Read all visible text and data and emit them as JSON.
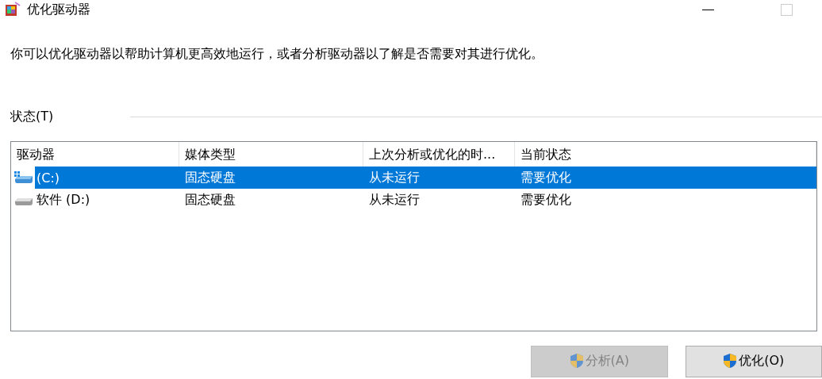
{
  "window": {
    "title": "优化驱动器"
  },
  "description": "你可以优化驱动器以帮助计算机更高效地运行，或者分析驱动器以了解是否需要对其进行优化。",
  "status_group": {
    "label": "状态(T)"
  },
  "table": {
    "columns": [
      "驱动器",
      "媒体类型",
      "上次分析或优化的时...",
      "当前状态"
    ],
    "rows": [
      {
        "kind": "system",
        "selected": true,
        "cells": [
          "(C:)",
          "固态硬盘",
          "从未运行",
          "需要优化"
        ]
      },
      {
        "kind": "data",
        "selected": false,
        "cells": [
          "软件 (D:)",
          "固态硬盘",
          "从未运行",
          "需要优化"
        ]
      }
    ]
  },
  "buttons": [
    {
      "label": "分析(A)",
      "disabled": true
    },
    {
      "label": "优化(O)",
      "disabled": false
    }
  ]
}
